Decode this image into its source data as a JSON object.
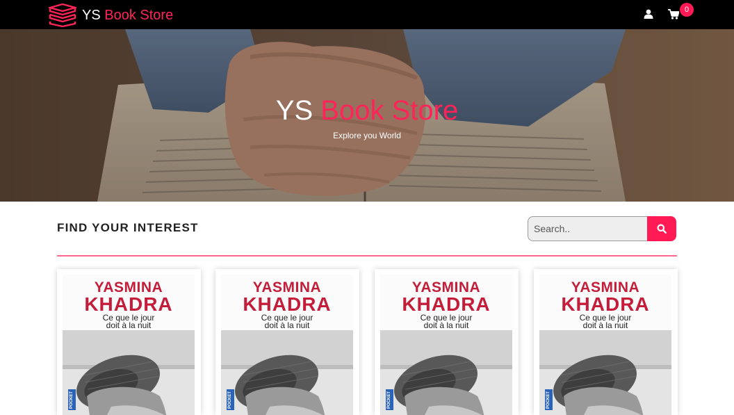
{
  "navbar": {
    "brand_ys": "YS",
    "brand_store": "Book Store",
    "user_icon": "user-icon",
    "cart_icon": "cart-icon",
    "cart_count": "0"
  },
  "hero": {
    "title_ys": "YS",
    "title_store": "Book Store",
    "subtitle": "Explore you World"
  },
  "main": {
    "section_title": "FIND YOUR INTEREST",
    "search": {
      "placeholder": "Search..",
      "button_icon": "search-icon"
    }
  },
  "books": [
    {
      "author_first": "YASMINA",
      "author_last": "KHADRA",
      "title_line1": "Ce que le jour",
      "title_line2": "doit à la nuit",
      "publisher": "POCKET"
    },
    {
      "author_first": "YASMINA",
      "author_last": "KHADRA",
      "title_line1": "Ce que le jour",
      "title_line2": "doit à la nuit",
      "publisher": "POCKET"
    },
    {
      "author_first": "YASMINA",
      "author_last": "KHADRA",
      "title_line1": "Ce que le jour",
      "title_line2": "doit à la nuit",
      "publisher": "POCKET"
    },
    {
      "author_first": "YASMINA",
      "author_last": "KHADRA",
      "title_line1": "Ce que le jour",
      "title_line2": "doit à la nuit",
      "publisher": "POCKET"
    }
  ],
  "colors": {
    "accent": "#ff1a55",
    "navbar_bg": "#000000",
    "cover_red": "#c41d3a"
  }
}
